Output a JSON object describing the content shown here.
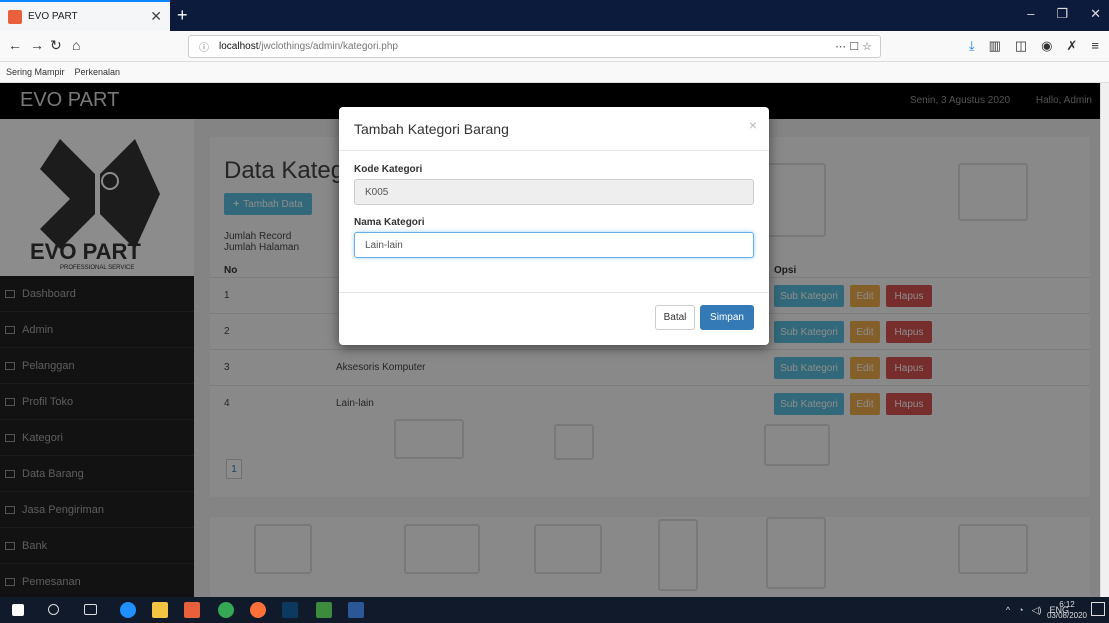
{
  "browser": {
    "tab_title": "EVO PART",
    "new_tab": "+",
    "url_host": "localhost",
    "url_path": "/jwclothings/admin/kategori.php",
    "url_actions": "⋯ ☐ ☆",
    "bookmarks": [
      "Sering Mampir",
      "Perkenalan"
    ],
    "window_controls": [
      "–",
      "❐",
      "✕"
    ]
  },
  "header": {
    "brand": "EVO PART",
    "date": "Senin, 3 Agustus 2020",
    "user": "Hallo, Admin"
  },
  "logo_text": "EVO PART",
  "logo_sub": "PROFESSIONAL SERVICE",
  "sidebar": {
    "items": [
      {
        "label": "Dashboard"
      },
      {
        "label": "Admin"
      },
      {
        "label": "Pelanggan"
      },
      {
        "label": "Profil Toko"
      },
      {
        "label": "Kategori"
      },
      {
        "label": "Data Barang"
      },
      {
        "label": "Jasa Pengiriman"
      },
      {
        "label": "Bank"
      },
      {
        "label": "Pemesanan"
      }
    ]
  },
  "main": {
    "title": "Data Katego",
    "add_button": "Tambah Data",
    "jumlah_record": "Jumlah Record",
    "jumlah_halaman": "Jumlah Halaman",
    "headers": {
      "no": "No",
      "opsi": "Opsi"
    },
    "rows": [
      {
        "no": "1",
        "nama": ""
      },
      {
        "no": "2",
        "nama": ""
      },
      {
        "no": "3",
        "nama": "Aksesoris Komputer"
      },
      {
        "no": "4",
        "nama": "Lain-lain"
      }
    ],
    "btn_sub": "Sub Kategori",
    "btn_edit": "Edit",
    "btn_hapus": "Hapus",
    "page": "1"
  },
  "modal": {
    "title": "Tambah Kategori Barang",
    "close": "×",
    "kode_label": "Kode Kategori",
    "kode_value": "K005",
    "nama_label": "Nama Kategori",
    "nama_value": "Lain-lain",
    "batal": "Batal",
    "simpan": "Simpan"
  },
  "taskbar": {
    "lang": "ENG",
    "time": "6:12",
    "date": "03/08/2020"
  }
}
